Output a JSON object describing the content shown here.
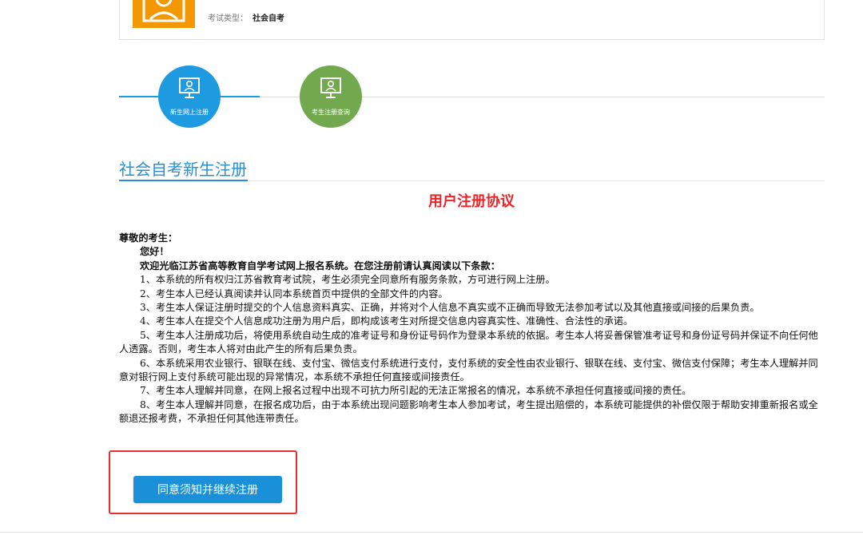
{
  "header": {
    "exam_type_label": "考试类型：",
    "exam_type_value": "社会自考",
    "avatar_color": "#f39800"
  },
  "steps": [
    {
      "label": "新生网上注册",
      "icon": "monitor-user-icon",
      "color": "#1e9be0",
      "active": true
    },
    {
      "label": "考生注册查询",
      "icon": "monitor-user-icon",
      "color": "#72a94e",
      "active": false
    }
  ],
  "section": {
    "title": "社会自考新生注册"
  },
  "agreement": {
    "title": "用户注册协议",
    "greeting": "尊敬的考生：",
    "hello": "您好！",
    "intro": "欢迎光临江苏省高等教育自学考试网上报名系统。在您注册前请认真阅读以下条款：",
    "clauses": [
      "1、本系统的所有权归江苏省教育考试院，考生必须完全同意所有服务条款，方可进行网上注册。",
      "2、考生本人已经认真阅读并认同本系统首页中提供的全部文件的内容。",
      "3、考生本人保证注册时提交的个人信息资料真实、正确，并将对个人信息不真实或不正确而导致无法参加考试以及其他直接或间接的后果负责。",
      "4、考生本人在提交个人信息成功注册为用户后，即构成该考生对所提交信息内容真实性、准确性、合法性的承诺。",
      "5、考生本人注册成功后，将使用系统自动生成的准考证号和身份证号码作为登录本系统的依据。考生本人将妥善保管准考证号和身份证号码并保证不向任何他人透露。否则，考生本人将对由此产生的所有后果负责。",
      "6、本系统采用农业银行、银联在线、支付宝、微信支付系统进行支付，支付系统的安全性由农业银行、银联在线、支付宝、微信支付保障；考生本人理解并同意对银行网上支付系统可能出现的异常情况，本系统不承担任何直接或间接责任。",
      "7、考生本人理解并同意，在网上报名过程中出现不可抗力所引起的无法正常报名的情况，本系统不承担任何直接或间接的责任。",
      "8、考生本人理解并同意，在报名成功后，由于本系统出现问题影响考生本人参加考试，考生提出赔偿的，本系统可能提供的补偿仅限于帮助安排重新报名或全额退还报考费，不承担任何其他连带责任。"
    ]
  },
  "actions": {
    "agree_button_label": "同意须知并继续注册"
  }
}
